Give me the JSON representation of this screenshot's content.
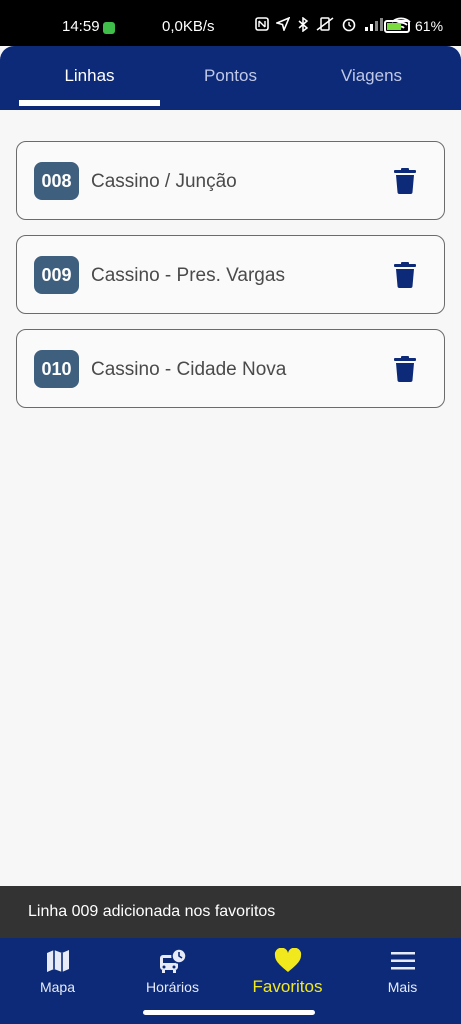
{
  "status_bar": {
    "time": "14:59",
    "network_speed": "0,0KB/s",
    "battery_percent": "61%"
  },
  "tabs": [
    {
      "label": "Linhas",
      "active": true
    },
    {
      "label": "Pontos",
      "active": false
    },
    {
      "label": "Viagens",
      "active": false
    }
  ],
  "favorites": [
    {
      "code": "008",
      "name": "Cassino / Junção"
    },
    {
      "code": "009",
      "name": "Cassino - Pres. Vargas"
    },
    {
      "code": "010",
      "name": "Cassino - Cidade Nova"
    }
  ],
  "snackbar": {
    "message": "Linha 009 adicionada nos favoritos"
  },
  "bottom_nav": [
    {
      "label": "Mapa",
      "icon": "map-icon",
      "active": false
    },
    {
      "label": "Horários",
      "icon": "bus-clock-icon",
      "active": false
    },
    {
      "label": "Favoritos",
      "icon": "heart-icon",
      "active": true
    },
    {
      "label": "Mais",
      "icon": "menu-icon",
      "active": false
    }
  ],
  "colors": {
    "primary": "#0d2a78",
    "badge": "#3e5f7e",
    "active_nav": "#f2e81e"
  }
}
